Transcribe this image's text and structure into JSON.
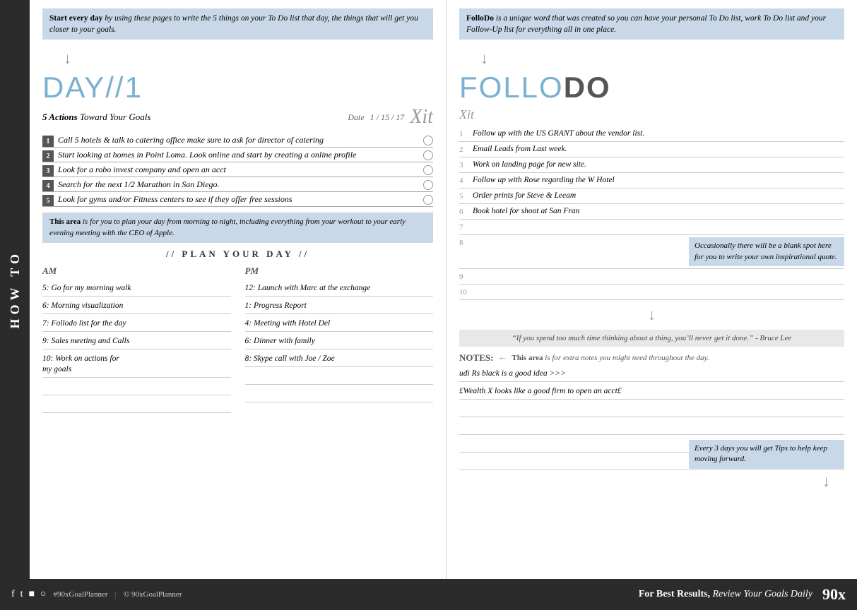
{
  "sidebar": {
    "label": "HOW TO"
  },
  "left": {
    "intro": {
      "bold_start": "Start every day",
      "text": " by using these pages to write the 5 things on your To Do list that day, the things that will get you closer to your goals."
    },
    "day_heading": "DAY//1",
    "five_actions_label": "5 Actions",
    "five_actions_sub": "Toward Your Goals",
    "date_label": "Date",
    "date_value": "1 / 15 / 17",
    "xit_label": "Xit",
    "actions": [
      {
        "num": "1",
        "text": "Call 5 hotels & talk to catering office make sure to ask for director of catering"
      },
      {
        "num": "2",
        "text": "Start looking at homes in Point Loma. Look online and start by creating a online profile"
      },
      {
        "num": "3",
        "text": "Look for a robo invest company and open an acct"
      },
      {
        "num": "4",
        "text": "Search for the next 1/2 Marathon in San Diego."
      },
      {
        "num": "5",
        "text": "Look for gyms and/or Fitness centers to see if they offer free sessions"
      }
    ],
    "this_area_bold": "This area",
    "this_area_text": " is for you to plan your day from morning to night, including everything from your workout to your early evening meeting with the CEO of Apple.",
    "plan_heading": "// PLAN YOUR DAY //",
    "am_label": "AM",
    "pm_label": "PM",
    "am_entries": [
      "5: Go for my morning walk",
      "6: Morning visualization",
      "7: Follodo list for the day",
      "9: Sales meeting and Calls",
      "10: Work on actions for my goals"
    ],
    "pm_entries": [
      "12: Launch with Marc at the exchange",
      "1: Progress Report",
      "4: Meeting with Hotel Del",
      "6: Dinner with family",
      "8: Skype call with Joe / Zoe"
    ]
  },
  "right": {
    "intro": {
      "bold_start": "FolloDo",
      "text": " is a unique word that was created so you can have your personal To Do list, work To Do list and your Follow-Up list for everything all in one place."
    },
    "follodo_heading_light": "FOLLO",
    "follodo_heading_bold": "DO",
    "xit_sub": "Xit",
    "followup_items": [
      {
        "num": "1",
        "text": "Follow up with the US GRANT about the vendor list."
      },
      {
        "num": "2",
        "text": "Email Leads from Last week."
      },
      {
        "num": "3",
        "text": "Work on landing page for new site."
      },
      {
        "num": "4",
        "text": "Follow up with Rose regarding the W Hotel"
      },
      {
        "num": "5",
        "text": "Order prints for Steve & Leeam"
      },
      {
        "num": "6",
        "text": "Book hotel for shoot at San Fran"
      },
      {
        "num": "7",
        "text": ""
      },
      {
        "num": "8",
        "text": ""
      },
      {
        "num": "9",
        "text": ""
      },
      {
        "num": "10",
        "text": ""
      }
    ],
    "blank_spot_note": "Occasionally there will be a blank spot here for you to write your own inspirational quote.",
    "quote": "“If you spend too much time thinking about a thing, you’ll never get it done.” - Bruce Lee",
    "notes_label": "NOTES:",
    "notes_desc_bold": "This area",
    "notes_desc_text": " is for extra notes you might need throughout the day.",
    "note_lines": [
      "udi Rs black is a good idea >>>",
      "£Wealth X looks like a good firm to open an acct£",
      "",
      "",
      "",
      ""
    ],
    "tips_note": "Every 3 days you will get Tips to help keep moving forward.",
    "arrow_label": "↓"
  },
  "footer": {
    "icons": [
      "f",
      "t",
      "■",
      "○"
    ],
    "hashtag": "#90xGoalPlanner",
    "copyright": "© 90xGoalPlanner",
    "tagline_bold": "For Best Results,",
    "tagline_rest": " Review Your Goals Daily",
    "logo": "90x"
  }
}
